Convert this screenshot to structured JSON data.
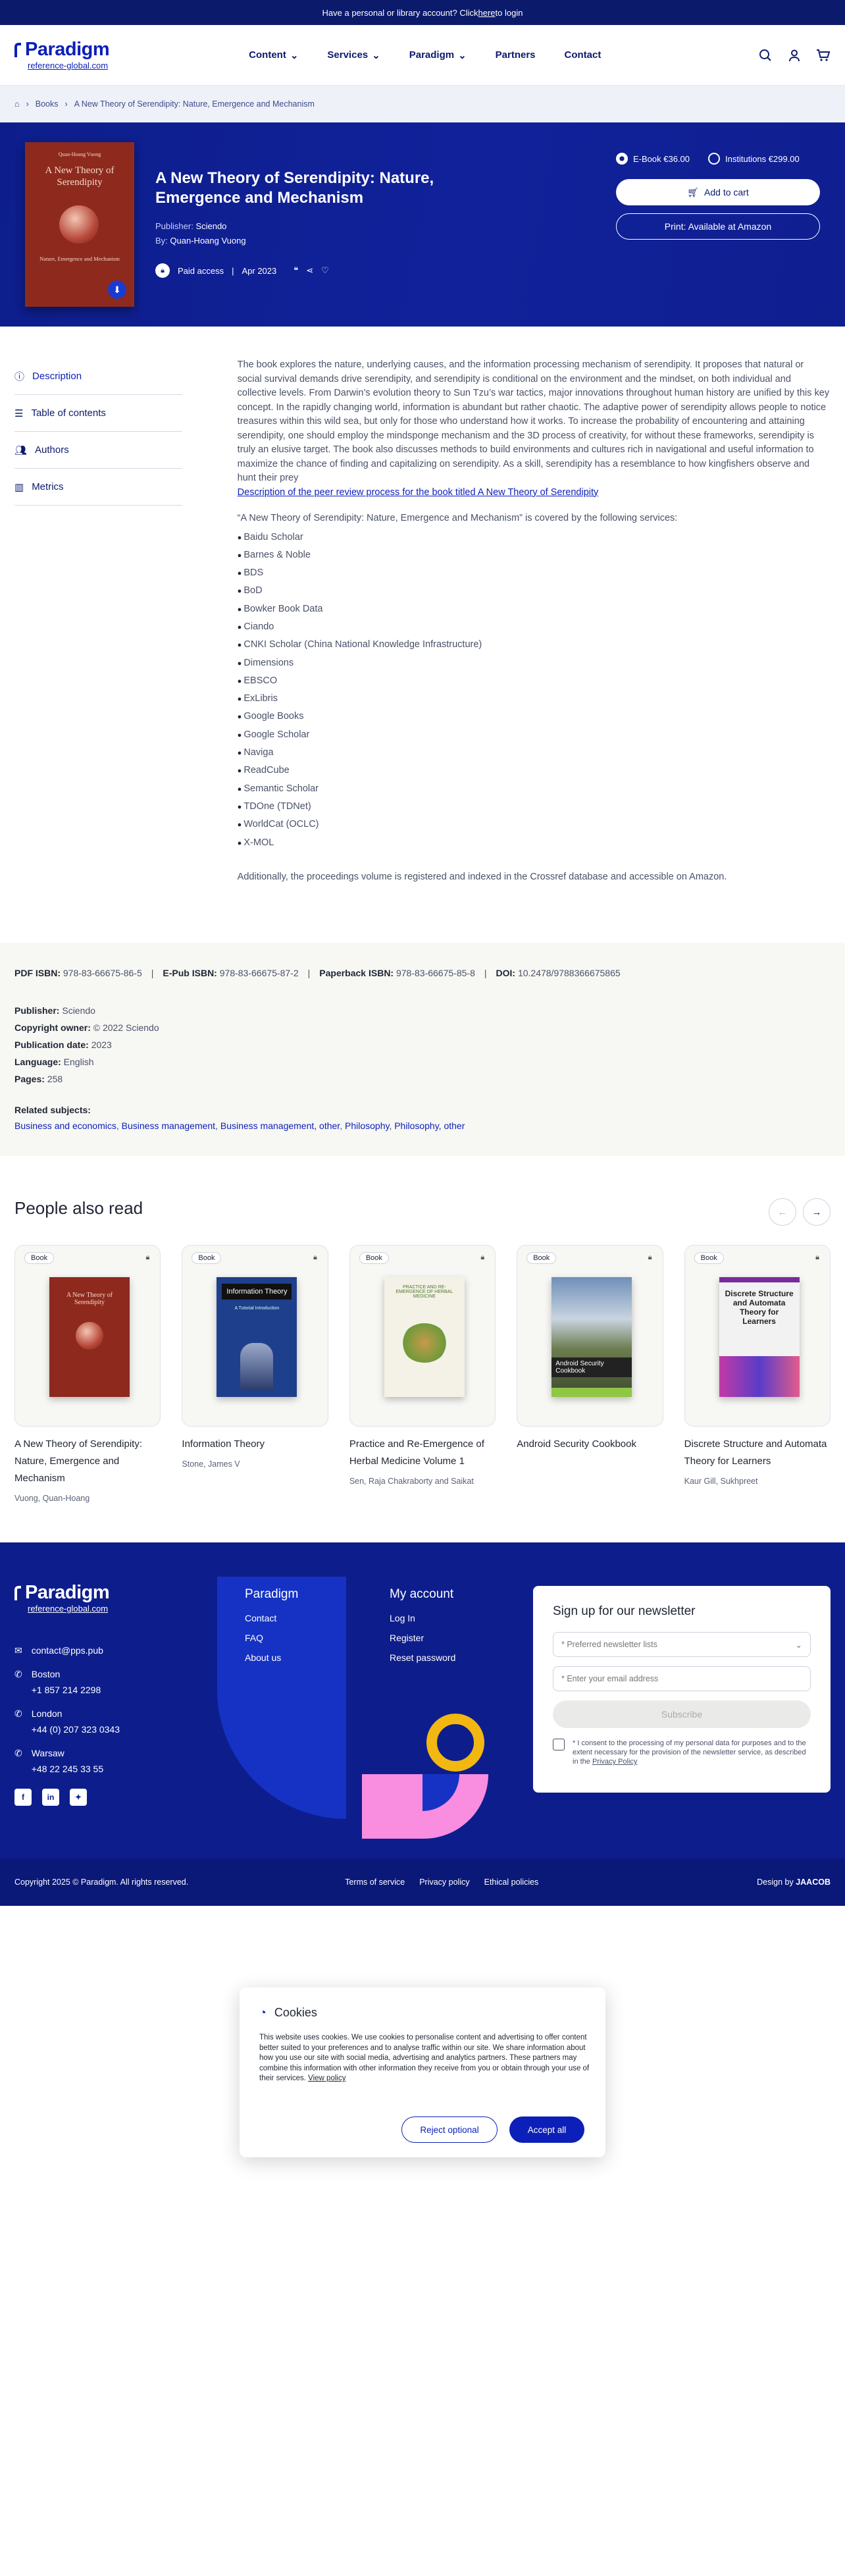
{
  "topbar": {
    "text": "Have a personal or library account? Click ",
    "link": "here",
    "after": " to login"
  },
  "brand": {
    "name": "Paradigm",
    "domain": "reference-global.com"
  },
  "nav": [
    {
      "label": "Content"
    },
    {
      "label": "Services"
    },
    {
      "label": "Paradigm"
    },
    {
      "label": "Partners"
    },
    {
      "label": "Contact"
    }
  ],
  "breadcrumb": [
    "Books",
    "A New Theory of Serendipity: Nature, Emergence and Mechanism"
  ],
  "book": {
    "title": "A New Theory of Serendipity: Nature, Emergence and Mechanism",
    "cover_title": "A New Theory of Serendipity",
    "cover_sub": "Nature, Emergence and Mechanism",
    "cover_author": "Quan-Hoang Vuong",
    "publisher_label": "Publisher:",
    "publisher": "Sciendo",
    "by_label": "By:",
    "author": "Quan-Hoang Vuong",
    "access": "Paid access",
    "date": "Apr 2023"
  },
  "purchase": {
    "ebook": "E-Book €36.00",
    "institutions": "Institutions €299.00",
    "add_to_cart": "Add to cart",
    "print": "Print: Available at Amazon"
  },
  "sidebar": [
    {
      "label": "Description"
    },
    {
      "label": "Table of contents"
    },
    {
      "label": "Authors"
    },
    {
      "label": "Metrics"
    }
  ],
  "description": "The book explores the nature, underlying causes, and the information processing mechanism of serendipity. It proposes that natural or social survival demands drive serendipity, and serendipity is conditional on the environment and the mindset, on both individual and collective levels. From Darwin’s evolution theory to Sun Tzu’s war tactics, major innovations throughout human history are unified by this key concept. In the rapidly changing world, information is abundant but rather chaotic. The adaptive power of serendipity allows people to notice treasures within this wild sea, but only for those who understand how it works. To increase the probability of encountering and attaining serendipity, one should employ the mindsponge mechanism and the 3D process of creativity, for without these frameworks, serendipity is truly an elusive target. The book also discusses methods to build environments and cultures rich in navigational and useful information to maximize the chance of finding and capitalizing on serendipity. As a skill, serendipity has a resemblance to how kingfishers observe and hunt their prey",
  "review_link": "Description of the peer review process for the book titled A New Theory of Serendipity",
  "covered_intro": "“A New Theory of Serendipity: Nature, Emergence and Mechanism” is covered by the following services:",
  "services": [
    "Baidu Scholar",
    "Barnes & Noble",
    "BDS",
    "BoD",
    "Bowker Book Data",
    "Ciando",
    "CNKI Scholar (China National Knowledge Infrastructure)",
    "Dimensions",
    "EBSCO",
    "ExLibris",
    "Google Books",
    "Google Scholar",
    "Naviga",
    "ReadCube",
    "Semantic Scholar",
    "TDOne (TDNet)",
    "WorldCat (OCLC)",
    "X-MOL"
  ],
  "additional": "Additionally, the proceedings volume is registered and indexed in the Crossref database and accessible on Amazon.",
  "isbn": [
    {
      "k": "PDF ISBN:",
      "v": "978-83-66675-86-5"
    },
    {
      "k": "E-Pub ISBN:",
      "v": "978-83-66675-87-2"
    },
    {
      "k": "Paperback ISBN:",
      "v": "978-83-66675-85-8"
    },
    {
      "k": "DOI:",
      "v": "10.2478/9788366675865"
    }
  ],
  "details": [
    {
      "k": "Publisher:",
      "v": "Sciendo"
    },
    {
      "k": "Copyright owner:",
      "v": "© 2022 Sciendo"
    },
    {
      "k": "Publication date:",
      "v": "2023"
    },
    {
      "k": "Language:",
      "v": "English"
    },
    {
      "k": "Pages:",
      "v": "258"
    }
  ],
  "related": {
    "label": "Related subjects:",
    "items": [
      "Business and economics",
      "Business management",
      "Business management, other",
      "Philosophy",
      "Philosophy, other"
    ]
  },
  "also_read": {
    "heading": "People also read",
    "badge": "Book",
    "cards": [
      {
        "title": "A New Theory of Serendipity: Nature, Emergence and Mechanism",
        "author": "Vuong, Quan-Hoang"
      },
      {
        "title": "Information Theory",
        "author": "Stone, James V"
      },
      {
        "title": "Practice and Re-Emergence of Herbal Medicine Volume 1",
        "author": "Sen, Raja Chakraborty and Saikat"
      },
      {
        "title": "Android Security Cookbook",
        "author": ""
      },
      {
        "title": "Discrete Structure and Automata Theory for Learners",
        "author": "Kaur Gill, Sukhpreet"
      }
    ]
  },
  "covers": {
    "c2_title": "Information Theory",
    "c2_sub": "A Tutorial Introduction",
    "c3_title": "PRACTICE AND RE-EMERGENCE OF HERBAL MEDICINE",
    "c4_title": "Android Security Cookbook",
    "c5_title": "Discrete Structure and Automata Theory for Learners"
  },
  "footer": {
    "email": "contact@pps.pub",
    "offices": [
      {
        "city": "Boston",
        "phone": "+1 857 214 2298"
      },
      {
        "city": "London",
        "phone": "+44 (0) 207 323 0343"
      },
      {
        "city": "Warsaw",
        "phone": "+48 22 245 33 55"
      }
    ],
    "col1": {
      "heading": "Paradigm",
      "links": [
        "Contact",
        "FAQ",
        "About us"
      ]
    },
    "col2": {
      "heading": "My account",
      "links": [
        "Log In",
        "Register",
        "Reset password"
      ]
    },
    "newsletter": {
      "heading": "Sign up for our newsletter",
      "select": "Preferred newsletter lists",
      "email": "Enter your email address",
      "subscribe": "Subscribe",
      "consent": "I consent to the processing of my personal data for purposes and to the extent necessary for the provision of the newsletter service, as described in the ",
      "privacy": "Privacy Policy"
    },
    "copyright": "Copyright 2025 © Paradigm. All rights reserved.",
    "links": [
      "Terms of service",
      "Privacy policy",
      "Ethical policies"
    ],
    "design": "Design by",
    "designer": "JAACOB"
  },
  "cookies": {
    "heading": "Cookies",
    "text": "This website uses cookies. We use cookies to personalise content and advertising to offer content better suited to your preferences and to analyse traffic within our site. We share information about how you use our site with social media, advertising and analytics partners. These partners may combine this information with other information they receive from you or obtain through your use of their services. ",
    "link": "View policy",
    "reject": "Reject optional",
    "accept": "Accept all"
  },
  "colors": {
    "navy": "#0d1e8c",
    "accent": "#0c1fb8",
    "yellow": "#f3b712",
    "pink": "#f98ddf"
  }
}
